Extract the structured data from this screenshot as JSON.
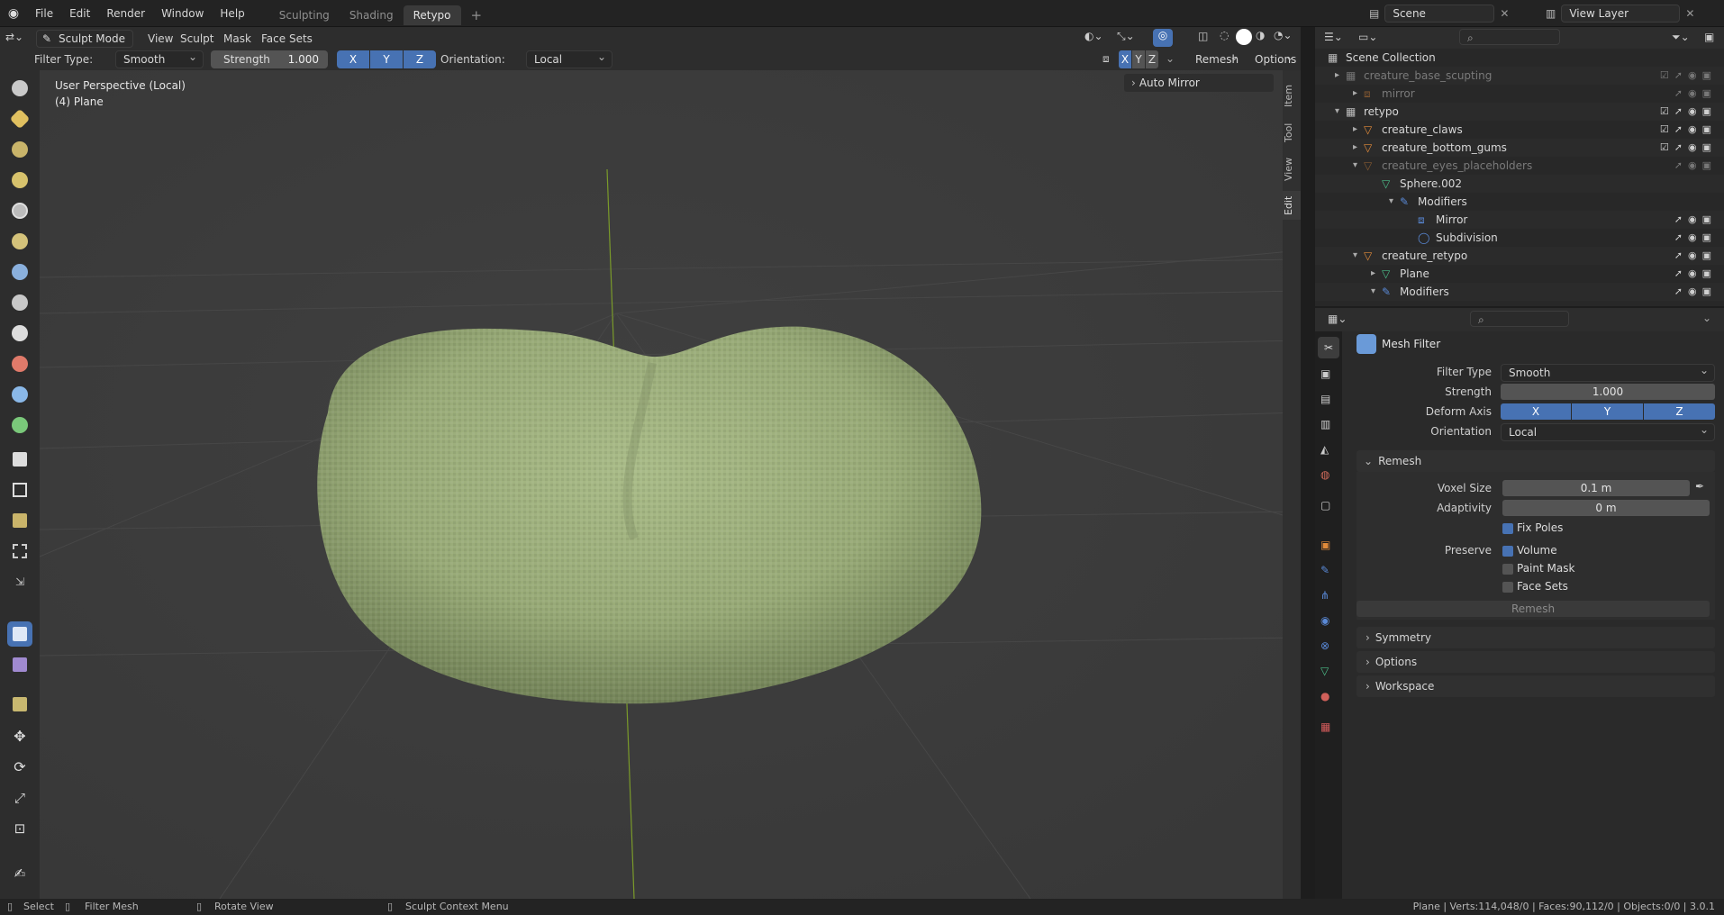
{
  "menubar": {
    "items": [
      "File",
      "Edit",
      "Render",
      "Window",
      "Help"
    ],
    "workspaces": [
      "Sculpting",
      "Shading",
      "Retypo"
    ],
    "active_workspace": "Retypo",
    "add_tab": "+",
    "scene": "Scene",
    "view_layer": "View Layer"
  },
  "viewport_header": {
    "mode": "Sculpt Mode",
    "menus": [
      "View",
      "Sculpt",
      "Mask",
      "Face Sets"
    ],
    "remesh": "Remesh",
    "options": "Options",
    "mirror_axes": [
      "X",
      "Y",
      "Z"
    ]
  },
  "tool_settings": {
    "filter_type_label": "Filter Type:",
    "filter_type": "Smooth",
    "strength_label": "Strength",
    "strength": "1.000",
    "axes": [
      "X",
      "Y",
      "Z"
    ],
    "orientation_label": "Orientation:",
    "orientation": "Local"
  },
  "viewport": {
    "perspective": "User Perspective (Local)",
    "object": "(4) Plane",
    "auto_mirror": "Auto Mirror",
    "side_tabs": [
      "Item",
      "Tool",
      "View",
      "Edit"
    ],
    "mesh_color": "#9aad7c",
    "grid_color": "#4a4a4a",
    "axis_y_color": "#7a9a2a"
  },
  "outliner": {
    "rows": [
      {
        "label": "Scene Collection",
        "depth": 0,
        "dim": false
      },
      {
        "label": "creature_base_scupting",
        "depth": 1,
        "dim": true
      },
      {
        "label": "mirror",
        "depth": 2,
        "dim": true
      },
      {
        "label": "retypo",
        "depth": 1,
        "dim": false
      },
      {
        "label": "creature_claws",
        "depth": 2,
        "dim": false
      },
      {
        "label": "creature_bottom_gums",
        "depth": 2,
        "dim": false
      },
      {
        "label": "creature_eyes_placeholders",
        "depth": 2,
        "dim": true
      },
      {
        "label": "Sphere.002",
        "depth": 3,
        "dim": false
      },
      {
        "label": "Modifiers",
        "depth": 4,
        "dim": false
      },
      {
        "label": "Mirror",
        "depth": 5,
        "dim": false
      },
      {
        "label": "Subdivision",
        "depth": 5,
        "dim": false
      },
      {
        "label": "creature_retypo",
        "depth": 2,
        "dim": false
      },
      {
        "label": "Plane",
        "depth": 3,
        "dim": false
      },
      {
        "label": "Modifiers",
        "depth": 3,
        "dim": false
      }
    ]
  },
  "properties": {
    "section_title": "Mesh Filter",
    "filter_type_label": "Filter Type",
    "filter_type": "Smooth",
    "strength_label": "Strength",
    "strength": "1.000",
    "deform_axis_label": "Deform Axis",
    "deform_axis": [
      "X",
      "Y",
      "Z"
    ],
    "orientation_label": "Orientation",
    "orientation": "Local",
    "remesh": {
      "title": "Remesh",
      "voxel_size_label": "Voxel Size",
      "voxel_size": "0.1 m",
      "adaptivity_label": "Adaptivity",
      "adaptivity": "0 m",
      "fix_poles": "Fix Poles",
      "preserve_label": "Preserve",
      "volume": "Volume",
      "paint_mask": "Paint Mask",
      "face_sets": "Face Sets",
      "button": "Remesh"
    },
    "panels": [
      "Symmetry",
      "Options",
      "Workspace"
    ]
  },
  "statusbar": {
    "select": "Select",
    "filter_mesh": "Filter Mesh",
    "rotate_view": "Rotate View",
    "context_menu": "Sculpt Context Menu",
    "stats": "Plane | Verts:114,048/0 | Faces:90,112/0 | Objects:0/0 | 3.0.1"
  },
  "accent_color": "#4772b3"
}
